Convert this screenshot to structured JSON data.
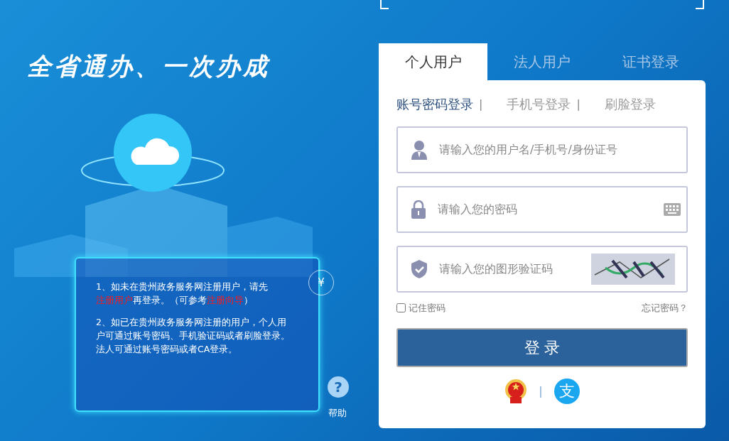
{
  "slogan": "全省通办、一次办成",
  "notice": {
    "badge": "¥",
    "paragraphs": [
      [
        {
          "kind": "text",
          "text": "1、如未在贵州政务服务网注册用户，请先"
        },
        {
          "kind": "link",
          "text": "注册用户"
        },
        {
          "kind": "text",
          "text": "再登录。（可参考"
        },
        {
          "kind": "link",
          "text": "注册向导"
        },
        {
          "kind": "text",
          "text": "）"
        }
      ],
      [
        {
          "kind": "text",
          "text": "2、如已在贵州政务服务网注册的用户，个人用户可通过账号密码、手机验证码或者刷脸登录。法人可通过账号密码或者CA登录。"
        }
      ]
    ]
  },
  "help": {
    "icon": "?",
    "label": "帮助"
  },
  "tabs": [
    {
      "label": "个人用户",
      "selected": true
    },
    {
      "label": "法人用户",
      "selected": false
    },
    {
      "label": "证书登录",
      "selected": false
    }
  ],
  "login_methods": [
    {
      "label": "账号密码登录",
      "selected": true
    },
    {
      "label": "手机号登录",
      "selected": false
    },
    {
      "label": "刷脸登录",
      "selected": false
    }
  ],
  "fields": [
    {
      "kind": "user",
      "placeholder": "请输入您的用户名/手机号/身份证号"
    },
    {
      "kind": "password",
      "placeholder": "请输入您的密码"
    },
    {
      "kind": "captcha",
      "placeholder": "请输入您的图形验证码"
    }
  ],
  "remember": {
    "label": "记住密码",
    "checked": false
  },
  "forgot": "忘记密码？",
  "login_button": "登 录",
  "separator": "|",
  "alipay_glyph": "支"
}
